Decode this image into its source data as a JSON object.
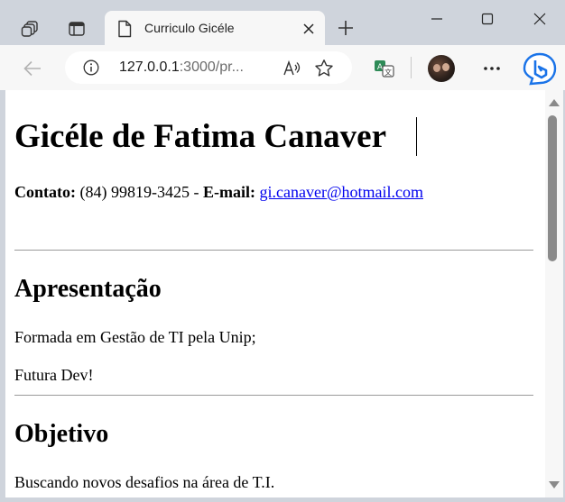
{
  "browser": {
    "tab": {
      "title": "Curriculo Gicéle"
    },
    "address": {
      "url_host": "127.0.0.1",
      "url_rest": ":3000/pr..."
    },
    "icons": {
      "workspaces": "tab-actions-icon",
      "tab_sidebar": "vertical-tabs-icon",
      "document": "document-icon",
      "close_tab": "close-icon",
      "new_tab": "plus-icon",
      "minimize": "minimize-icon",
      "maximize": "maximize-icon",
      "close_window": "close-window-icon",
      "back": "back-arrow-icon",
      "info": "info-icon",
      "read_aloud": "read-aloud-icon",
      "favorites": "star-icon",
      "translate": "translate-icon",
      "profile": "profile-avatar",
      "more": "more-icon",
      "copilot": "bing-copilot-icon"
    }
  },
  "page": {
    "name": "Gicéle de Fatima Canaver",
    "contact": {
      "label": "Contato:",
      "phone": " (84) 99819-3425 - ",
      "email_label": "E-mail:",
      "email_user": "gi.canaver",
      "email_domain": "@hotmail.com"
    },
    "sections": [
      {
        "heading": "Apresentação",
        "lines": [
          "Formada em Gestão de TI pela Unip;",
          "Futura Dev!"
        ]
      },
      {
        "heading": "Objetivo",
        "lines": [
          "Buscando novos desafios na área de T.I."
        ]
      }
    ]
  },
  "colors": {
    "chrome": "#cfd4dc",
    "toolbar": "#f7f7f7",
    "link": "#0000ee",
    "copilot_blue": "#1a73e8"
  }
}
